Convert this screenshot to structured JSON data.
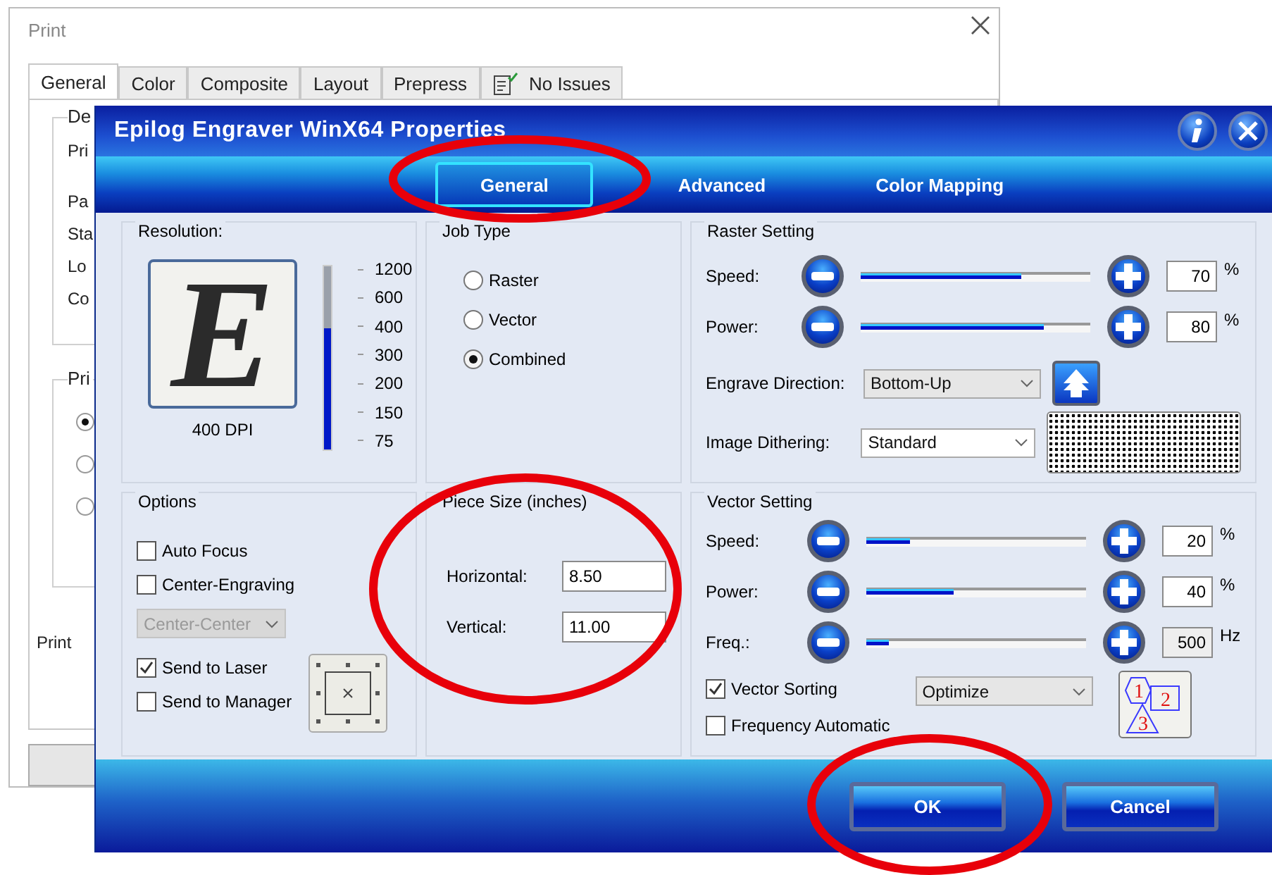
{
  "print_dialog": {
    "title": "Print",
    "tabs": [
      {
        "label": "General",
        "selected": true,
        "kind": "plain"
      },
      {
        "label": "Color",
        "selected": false,
        "kind": "plain"
      },
      {
        "label": "Composite",
        "selected": false,
        "kind": "plain"
      },
      {
        "label": "Layout",
        "selected": false,
        "kind": "plain"
      },
      {
        "label": "Prepress",
        "selected": false,
        "kind": "plain"
      },
      {
        "label": "No Issues",
        "selected": false,
        "kind": "status"
      }
    ],
    "device_group": {
      "label": "De",
      "rows": [
        "Pri",
        "Pa",
        "Sta",
        "Lo",
        "Co"
      ]
    },
    "range_group": {
      "label": "Pri",
      "options": [
        {
          "selected": true
        },
        {
          "selected": false
        },
        {
          "selected": false
        }
      ]
    },
    "footer_label": "Print"
  },
  "properties_dialog": {
    "title": "Epilog Engraver WinX64 Properties",
    "tabs": [
      {
        "label": "General",
        "selected": true
      },
      {
        "label": "Advanced",
        "selected": false
      },
      {
        "label": "Color Mapping",
        "selected": false
      }
    ],
    "resolution": {
      "title": "Resolution:",
      "preview_letter": "E",
      "dpi": "400 DPI",
      "level": 0.66,
      "ticks": [
        "1200",
        "600",
        "400",
        "300",
        "200",
        "150",
        "75"
      ]
    },
    "job_type": {
      "title": "Job Type",
      "options": [
        {
          "label": "Raster",
          "selected": false
        },
        {
          "label": "Vector",
          "selected": false
        },
        {
          "label": "Combined",
          "selected": true
        }
      ]
    },
    "options": {
      "title": "Options",
      "items": [
        {
          "kind": "checkbox",
          "label": "Auto Focus",
          "checked": false
        },
        {
          "kind": "checkbox",
          "label": "Center-Engraving",
          "checked": false
        },
        {
          "kind": "dropdown",
          "value": "Center-Center",
          "disabled": true
        },
        {
          "kind": "checkbox",
          "label": "Send to Laser",
          "checked": true
        },
        {
          "kind": "checkbox",
          "label": "Send to Manager",
          "checked": false
        }
      ]
    },
    "piece_size": {
      "title": "Piece Size (inches)",
      "fields": [
        {
          "label": "Horizontal:",
          "value": "8.50"
        },
        {
          "label": "Vertical:",
          "value": "11.00"
        }
      ]
    },
    "raster": {
      "title": "Raster Setting",
      "sliders": [
        {
          "label": "Speed:",
          "value": "70",
          "unit": "%",
          "level": 0.7,
          "readonly": false
        },
        {
          "label": "Power:",
          "value": "80",
          "unit": "%",
          "level": 0.8,
          "readonly": false
        }
      ],
      "engrave_direction": {
        "label": "Engrave Direction:",
        "value": "Bottom-Up"
      },
      "dithering": {
        "label": "Image Dithering:",
        "value": "Standard"
      }
    },
    "vector": {
      "title": "Vector Setting",
      "sliders": [
        {
          "label": "Speed:",
          "value": "20",
          "unit": "%",
          "level": 0.2,
          "readonly": false
        },
        {
          "label": "Power:",
          "value": "40",
          "unit": "%",
          "level": 0.4,
          "readonly": false
        },
        {
          "label": "Freq.:",
          "value": "500",
          "unit": "Hz",
          "level": 0.1,
          "readonly": true
        }
      ],
      "vector_sorting": {
        "label": "Vector Sorting",
        "checked": true
      },
      "sort_mode": {
        "value": "Optimize"
      },
      "sort_icon_labels": [
        "1",
        "2",
        "3"
      ],
      "frequency_automatic": {
        "label": "Frequency Automatic",
        "checked": false
      }
    },
    "buttons": [
      {
        "label": "OK"
      },
      {
        "label": "Cancel"
      }
    ]
  }
}
